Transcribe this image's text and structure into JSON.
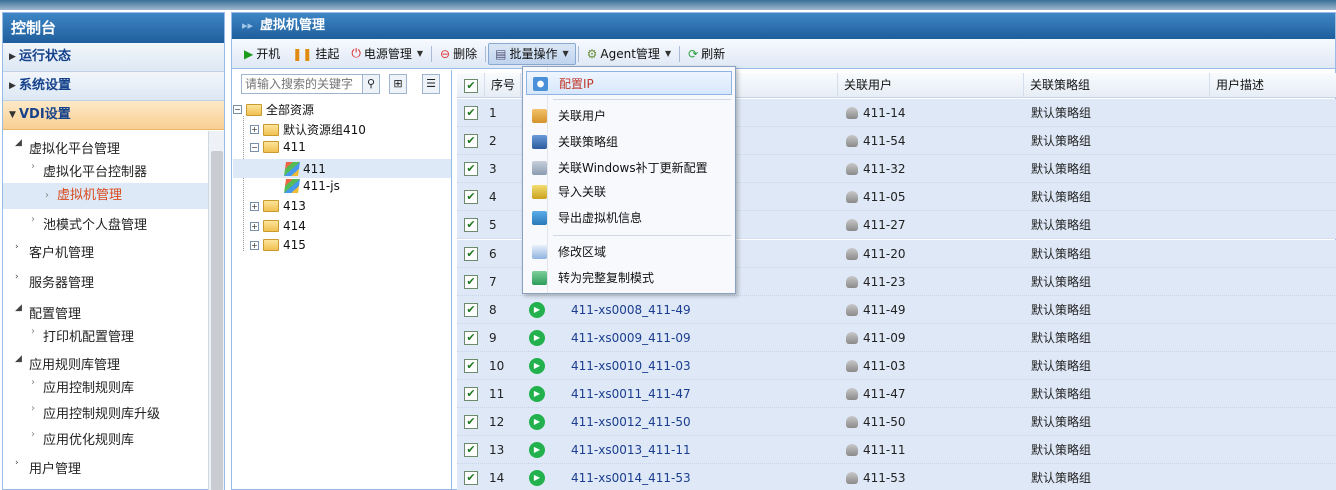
{
  "left": {
    "title": "控制台",
    "accordion": [
      {
        "label": "运行状态"
      },
      {
        "label": "系统设置"
      },
      {
        "label": "VDI设置"
      }
    ],
    "groups": [
      {
        "label": "虚拟化平台管理"
      },
      {
        "label": "客户机管理"
      },
      {
        "label": "服务器管理"
      },
      {
        "label": "配置管理"
      },
      {
        "label": "应用规则库管理"
      },
      {
        "label": "用户管理"
      }
    ],
    "subs": [
      {
        "label": "虚拟化平台控制器"
      },
      {
        "label": "虚拟机管理"
      },
      {
        "label": "池模式个人盘管理"
      },
      {
        "label": "打印机配置管理"
      },
      {
        "label": "应用控制规则库"
      },
      {
        "label": "应用控制规则库升级"
      },
      {
        "label": "应用优化规则库"
      }
    ]
  },
  "main": {
    "title": "虚拟机管理",
    "toolbar": {
      "power_on": "开机",
      "suspend": "挂起",
      "power_mgmt": "电源管理",
      "delete": "删除",
      "batch": "批量操作",
      "agent": "Agent管理",
      "refresh": "刷新"
    },
    "search_placeholder": "请输入搜索的关键字",
    "tree": {
      "root": "全部资源",
      "default_group": "默认资源组410",
      "n411": "411",
      "n411_child": "411",
      "n411_js": "411-js",
      "n413": "413",
      "n414": "414",
      "n415": "415"
    },
    "columns": {
      "seq": "序号",
      "user": "关联用户",
      "policy": "关联策略组",
      "desc": "用户描述"
    },
    "rows": [
      {
        "seq": "1",
        "vm": "",
        "user": "411-14",
        "policy": "默认策略组"
      },
      {
        "seq": "2",
        "vm": "",
        "user": "411-54",
        "policy": "默认策略组"
      },
      {
        "seq": "3",
        "vm": "",
        "user": "411-32",
        "policy": "默认策略组"
      },
      {
        "seq": "4",
        "vm": "",
        "user": "411-05",
        "policy": "默认策略组"
      },
      {
        "seq": "5",
        "vm": "",
        "user": "411-27",
        "policy": "默认策略组"
      },
      {
        "seq": "6",
        "vm": "",
        "user": "411-20",
        "policy": "默认策略组"
      },
      {
        "seq": "7",
        "vm": "",
        "user": "411-23",
        "policy": "默认策略组"
      },
      {
        "seq": "8",
        "vm": "411-xs0008_411-49",
        "user": "411-49",
        "policy": "默认策略组"
      },
      {
        "seq": "9",
        "vm": "411-xs0009_411-09",
        "user": "411-09",
        "policy": "默认策略组"
      },
      {
        "seq": "10",
        "vm": "411-xs0010_411-03",
        "user": "411-03",
        "policy": "默认策略组"
      },
      {
        "seq": "11",
        "vm": "411-xs0011_411-47",
        "user": "411-47",
        "policy": "默认策略组"
      },
      {
        "seq": "12",
        "vm": "411-xs0012_411-50",
        "user": "411-50",
        "policy": "默认策略组"
      },
      {
        "seq": "13",
        "vm": "411-xs0013_411-11",
        "user": "411-11",
        "policy": "默认策略组"
      },
      {
        "seq": "14",
        "vm": "411-xs0014_411-53",
        "user": "411-53",
        "policy": "默认策略组"
      }
    ]
  },
  "menu": {
    "items": [
      {
        "label": "配置IP",
        "icon": "config-ip-icon",
        "color": "#4a90d9"
      },
      {
        "label": "关联用户",
        "icon": "user-link-icon",
        "color": "#e0a030"
      },
      {
        "label": "关联策略组",
        "icon": "policy-link-icon",
        "color": "#3b6fb6"
      },
      {
        "label": "关联Windows补丁更新配置",
        "icon": "windows-patch-icon",
        "color": "#8a9bb0"
      },
      {
        "label": "导入关联",
        "icon": "import-icon",
        "color": "#d6b12a"
      },
      {
        "label": "导出虚拟机信息",
        "icon": "export-icon",
        "color": "#3a8fd0"
      },
      {
        "label": "修改区域",
        "icon": "edit-region-icon",
        "color": "#6a9fd8"
      },
      {
        "label": "转为完整复制模式",
        "icon": "full-copy-icon",
        "color": "#2c9c5a"
      }
    ]
  }
}
